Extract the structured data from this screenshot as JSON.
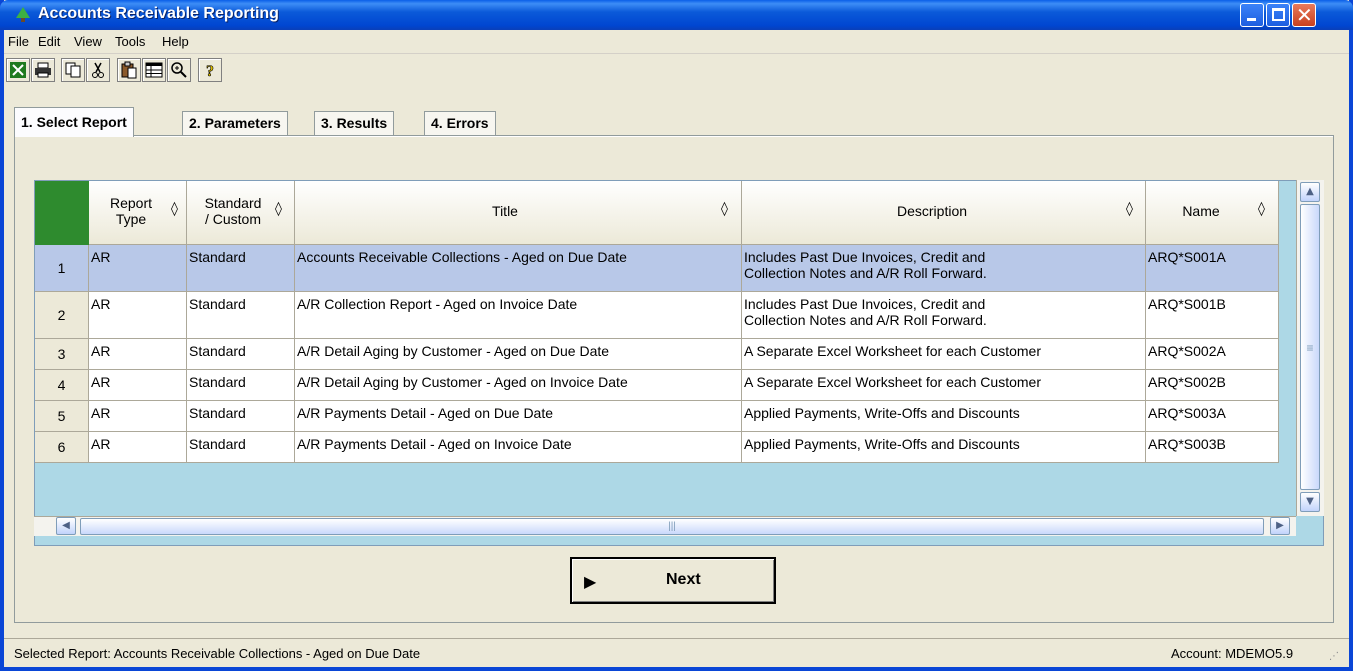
{
  "window": {
    "title": "Accounts Receivable Reporting"
  },
  "menu": [
    "File",
    "Edit",
    "View",
    "Tools",
    "Help"
  ],
  "toolbar": {
    "icons": [
      "excel-icon",
      "print-icon",
      "copy-icon",
      "cut-icon",
      "paste-icon",
      "grid-view-icon",
      "zoom-icon",
      "help-icon"
    ]
  },
  "tabs": [
    {
      "label": "1. Select Report",
      "active": true
    },
    {
      "label": "2. Parameters",
      "active": false
    },
    {
      "label": "3. Results",
      "active": false
    },
    {
      "label": "4. Errors",
      "active": false
    }
  ],
  "grid": {
    "columns": [
      {
        "label_line1": "Report",
        "label_line2": "Type"
      },
      {
        "label_line1": "Standard",
        "label_line2": "/ Custom"
      },
      {
        "label_line1": "Title",
        "label_line2": ""
      },
      {
        "label_line1": "Description",
        "label_line2": ""
      },
      {
        "label_line1": "Name",
        "label_line2": ""
      }
    ],
    "sort_glyph": "◊",
    "rows": [
      {
        "num": "1",
        "type": "AR",
        "std": "Standard",
        "title": "Accounts Receivable Collections - Aged on Due Date",
        "desc1": "Includes Past Due Invoices, Credit and",
        "desc2": "Collection Notes and A/R Roll Forward.",
        "name": "ARQ*S001A"
      },
      {
        "num": "2",
        "type": "AR",
        "std": "Standard",
        "title": "A/R Collection Report - Aged on Invoice Date",
        "desc1": "Includes Past Due Invoices, Credit and",
        "desc2": "Collection Notes and A/R Roll Forward.",
        "name": "ARQ*S001B"
      },
      {
        "num": "3",
        "type": "AR",
        "std": "Standard",
        "title": "A/R Detail Aging by Customer - Aged on Due Date",
        "desc1": "A Separate Excel Worksheet for each Customer",
        "desc2": "",
        "name": "ARQ*S002A"
      },
      {
        "num": "4",
        "type": "AR",
        "std": "Standard",
        "title": "A/R Detail Aging by Customer - Aged on Invoice Date",
        "desc1": "A Separate Excel Worksheet for each Customer",
        "desc2": "",
        "name": "ARQ*S002B"
      },
      {
        "num": "5",
        "type": "AR",
        "std": "Standard",
        "title": "A/R Payments Detail - Aged on Due Date",
        "desc1": "Applied Payments, Write-Offs and Discounts",
        "desc2": "",
        "name": "ARQ*S003A"
      },
      {
        "num": "6",
        "type": "AR",
        "std": "Standard",
        "title": "A/R Payments Detail - Aged on Invoice Date",
        "desc1": "Applied Payments, Write-Offs and Discounts",
        "desc2": "",
        "name": "ARQ*S003B"
      }
    ]
  },
  "next_button": {
    "label": "Next"
  },
  "status": {
    "left": "Selected Report: Accounts Receivable Collections - Aged on Due Date",
    "right": "Account: MDEMO5.9"
  },
  "colors": {
    "titlebar": "#0046d1",
    "selected_row": "#b8c8e8",
    "grid_bg": "#add8e6",
    "corner": "#2e8b2e"
  }
}
